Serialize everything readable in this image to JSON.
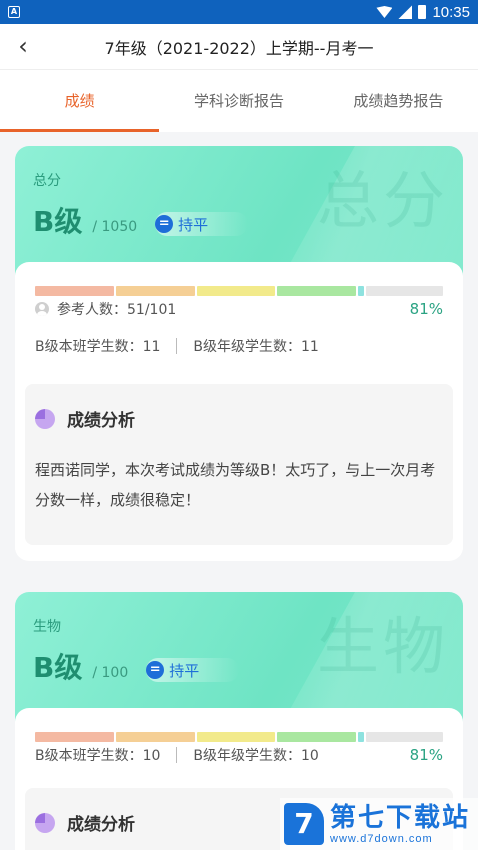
{
  "statusbar": {
    "app_icon": "A",
    "time": "10:35"
  },
  "header": {
    "back_icon": "‹",
    "title": "7年级（2021-2022）上学期--月考一"
  },
  "tabs": [
    {
      "label": "成绩",
      "active": true
    },
    {
      "label": "学科诊断报告",
      "active": false
    },
    {
      "label": "成绩趋势报告",
      "active": false
    }
  ],
  "colors": {
    "accent": "#e8632a",
    "teal": "#2ba383",
    "badge_blue": "#1e6ed8"
  },
  "bar_colors": [
    "#f4b9a2",
    "#f5cf95",
    "#f2ea8b",
    "#a9e7a0",
    "#8ee2df",
    "#e6e6e6"
  ],
  "cards": [
    {
      "subject": "总分",
      "watermark": "总分",
      "grade": "B级",
      "total": "/ 1050",
      "badge": "持平",
      "participants": "参考人数：51/101",
      "percentile": "81%",
      "class_count": "B级本班学生数：11",
      "grade_count": "B级年级学生数：11",
      "analysis_title": "成绩分析",
      "analysis_text": "程西诺同学，本次考试成绩为等级B！太巧了，与上一次月考分数一样，成绩很稳定！"
    },
    {
      "subject": "生物",
      "watermark": "生物",
      "grade": "B级",
      "total": "/ 100",
      "badge": "持平",
      "percentile": "81%",
      "class_count": "B级本班学生数：10",
      "grade_count": "B级年级学生数：10",
      "analysis_title": "成绩分析"
    }
  ],
  "logo": {
    "mark": "7",
    "name": "第七下载站",
    "url": "www.d7down.com"
  }
}
